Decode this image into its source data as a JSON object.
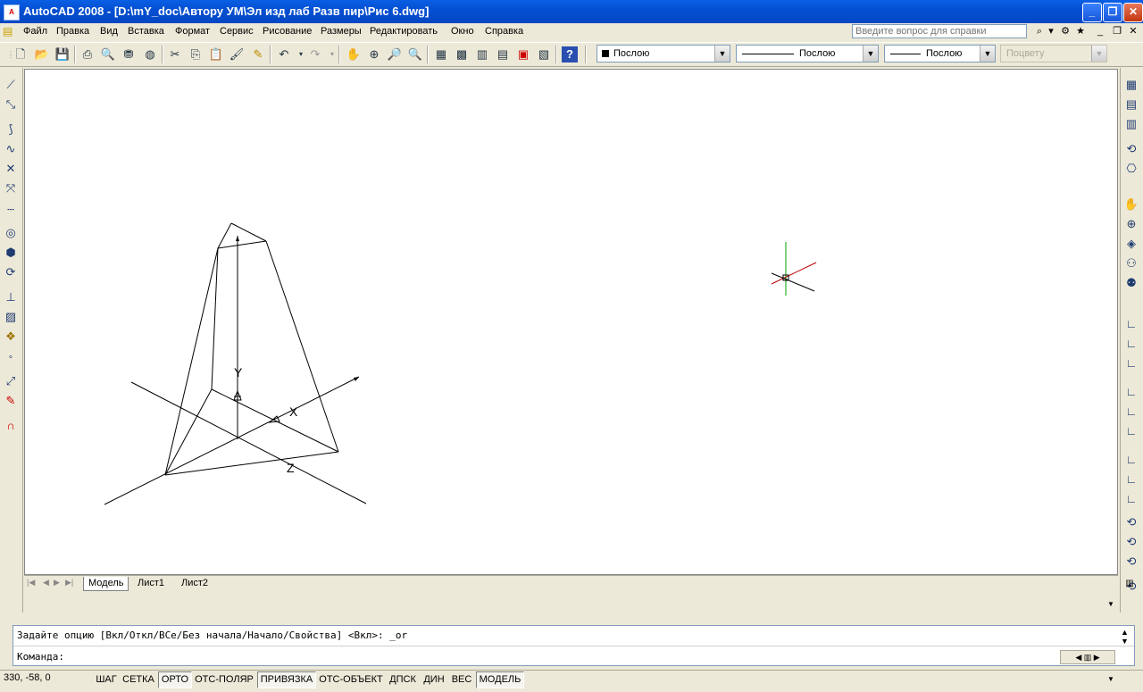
{
  "window": {
    "title": "AutoCAD 2008 - [D:\\mY_doc\\Автору УМ\\Эл изд лаб Разв пир\\Рис 6.dwg]"
  },
  "menu": [
    "Файл",
    "Правка",
    "Вид",
    "Вставка",
    "Формат",
    "Сервис",
    "Рисование",
    "Размеры",
    "Редактировать",
    "Окно",
    "Справка"
  ],
  "help": {
    "placeholder": "Введите вопрос для справки"
  },
  "properties": {
    "color": "Послою",
    "linetype": "Послою",
    "lineweight": "Послою",
    "plotstyle": "Поцвету"
  },
  "layout_tabs": [
    "Модель",
    "Лист1",
    "Лист2"
  ],
  "command": {
    "history": "Задайте опцию [Вкл/Откл/ВСе/Без начала/Начало/Свойства] <Вкл>: _or",
    "prompt": "Команда:"
  },
  "status": {
    "coords": "330, -58, 0",
    "buttons": [
      {
        "label": "ШАГ",
        "on": false
      },
      {
        "label": "СЕТКА",
        "on": false
      },
      {
        "label": "ОРТО",
        "on": true
      },
      {
        "label": "ОТС-ПОЛЯР",
        "on": false
      },
      {
        "label": "ПРИВЯЗКА",
        "on": true
      },
      {
        "label": "ОТС-ОБЪЕКТ",
        "on": false
      },
      {
        "label": "ДПСК",
        "on": false
      },
      {
        "label": "ДИН",
        "on": false
      },
      {
        "label": "ВЕС",
        "on": false
      },
      {
        "label": "МОДЕЛЬ",
        "on": true
      }
    ]
  },
  "ucs_labels": {
    "x": "X",
    "y": "Y",
    "z": "Z"
  },
  "colors": {
    "titlebar": "#0450d2",
    "ucs_x": "#c00000",
    "ucs_y": "#00a000"
  }
}
